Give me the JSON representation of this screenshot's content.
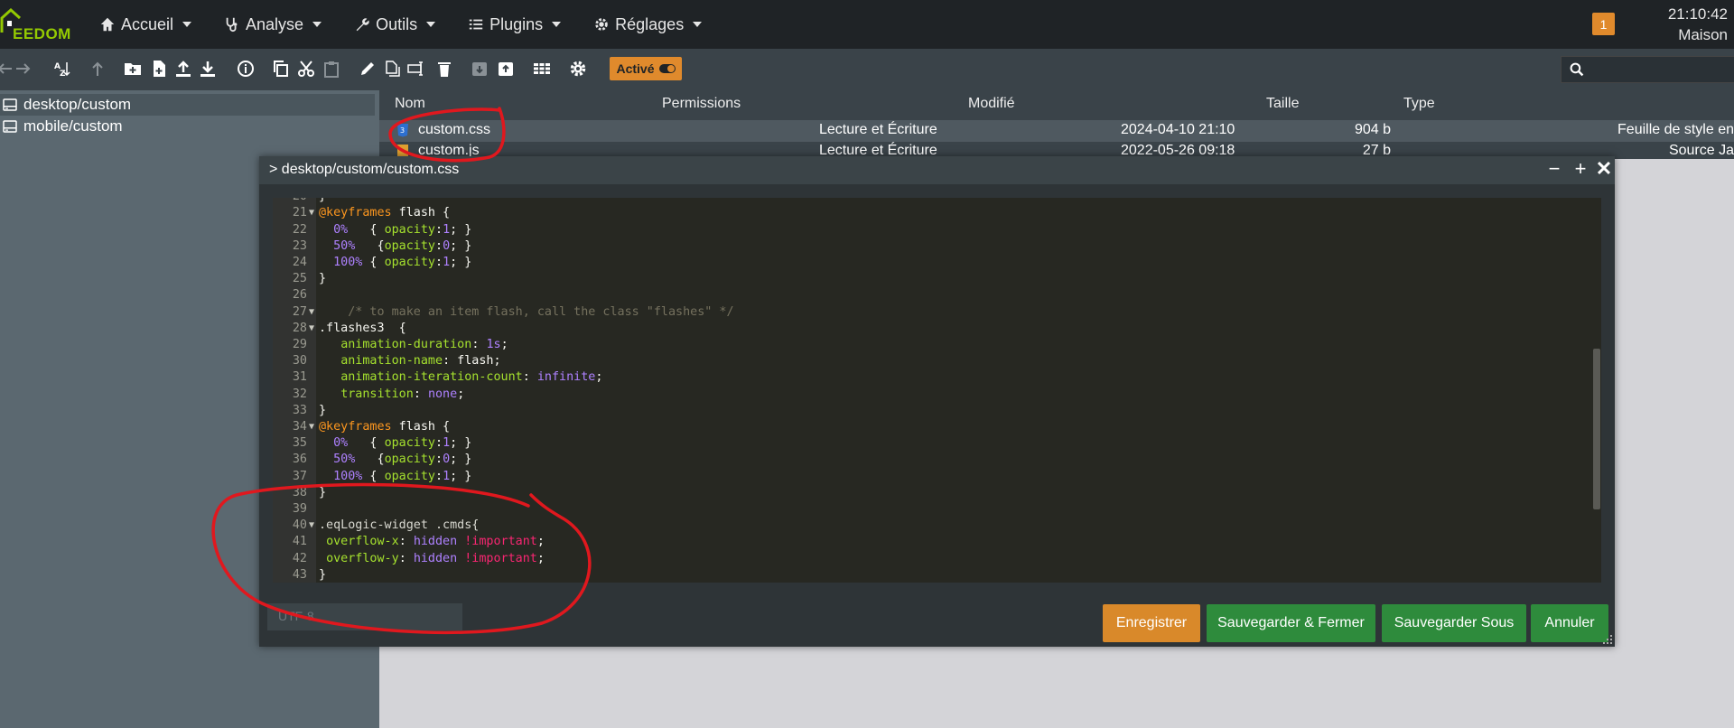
{
  "nav": {
    "logo_text": "EEDOM",
    "menu": [
      {
        "label": "Accueil",
        "icon": "home-icon"
      },
      {
        "label": "Analyse",
        "icon": "stethoscope-icon"
      },
      {
        "label": "Outils",
        "icon": "wrench-icon"
      },
      {
        "label": "Plugins",
        "icon": "list-icon"
      },
      {
        "label": "Réglages",
        "icon": "gear-icon"
      }
    ],
    "badge": "1",
    "time": "21:10:42",
    "location": "Maison"
  },
  "toolbar": {
    "active_label": "Activé",
    "search_placeholder": ""
  },
  "tree": {
    "items": [
      {
        "label": "desktop/custom",
        "selected": true
      },
      {
        "label": "mobile/custom",
        "selected": false
      }
    ]
  },
  "filelist": {
    "headers": {
      "name": "Nom",
      "permissions": "Permissions",
      "modified": "Modifié",
      "size": "Taille",
      "type": "Type"
    },
    "rows": [
      {
        "name": "custom.css",
        "permissions": "Lecture et Écriture",
        "modified": "2024-04-10 21:10",
        "size": "904 b",
        "type": "Feuille de style en"
      },
      {
        "name": "custom.js",
        "permissions": "Lecture et Écriture",
        "modified": "2022-05-26 09:18",
        "size": "27 b",
        "type": "Source Ja"
      }
    ]
  },
  "modal": {
    "title": "> desktop/custom/custom.css",
    "encoding": "UTF-8",
    "buttons": {
      "save": "Enregistrer",
      "save_close": "Sauvegarder & Fermer",
      "save_as": "Sauvegarder Sous",
      "cancel": "Annuler"
    }
  },
  "colors": {
    "accent_orange": "#e08a2c",
    "button_green": "#2e8b3c",
    "annotation_red": "#e0181e"
  }
}
